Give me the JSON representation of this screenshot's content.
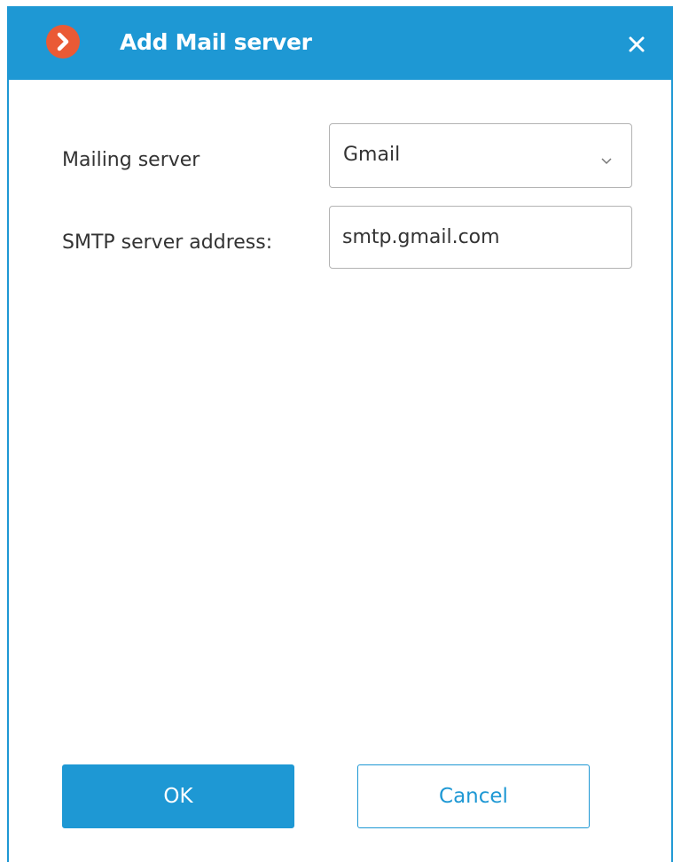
{
  "dialog": {
    "title": "Add Mail server",
    "logo_icon": "chevron-right-icon",
    "close_icon": "close-icon",
    "accent_color": "#1e98d4",
    "logo_color": "#ea5a35"
  },
  "form": {
    "mailing_server": {
      "label": "Mailing server",
      "value": "Gmail",
      "dropdown_icon": "chevron-down-icon"
    },
    "smtp_address": {
      "label": "SMTP server address:",
      "value": "smtp.gmail.com"
    }
  },
  "buttons": {
    "ok_label": "OK",
    "cancel_label": "Cancel"
  }
}
